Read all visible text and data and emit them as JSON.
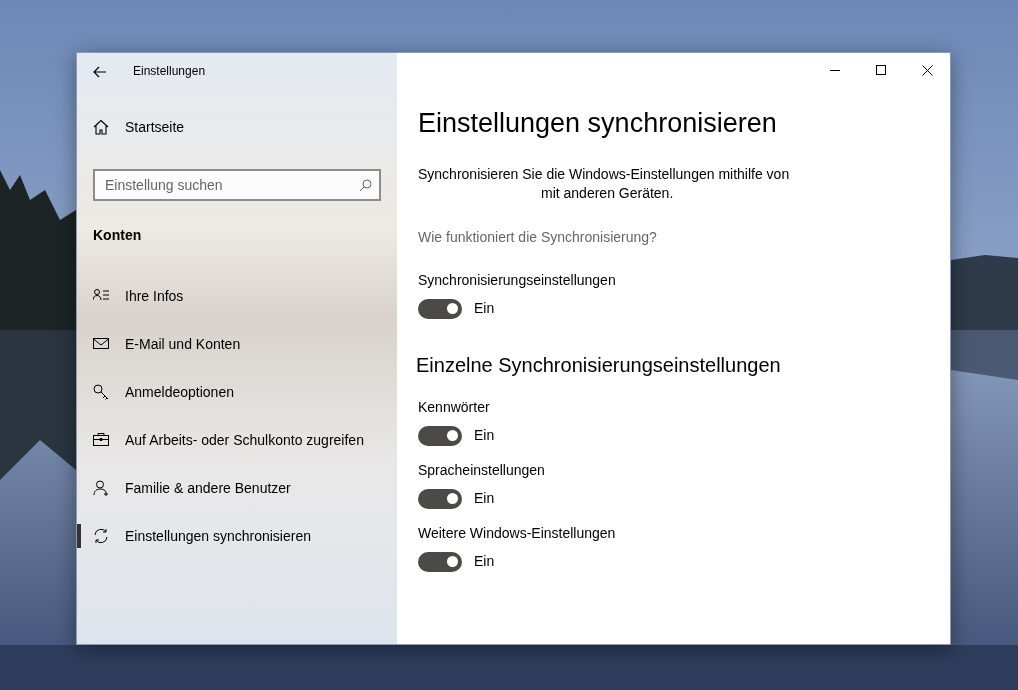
{
  "window": {
    "title": "Einstellungen"
  },
  "sidebar": {
    "home": "Startseite",
    "search": {
      "placeholder": "Einstellung suchen"
    },
    "section": "Konten",
    "items": [
      {
        "label": "Ihre Infos",
        "kind": "info",
        "selected": false
      },
      {
        "label": "E-Mail und Konten",
        "kind": "mail",
        "selected": false
      },
      {
        "label": "Anmeldeoptionen",
        "kind": "signin",
        "selected": false
      },
      {
        "label": "Auf Arbeits- oder Schulkonto zugreifen",
        "kind": "work",
        "selected": false
      },
      {
        "label": "Familie & andere Benutzer",
        "kind": "family",
        "selected": false
      },
      {
        "label": "Einstellungen synchronisieren",
        "kind": "sync",
        "selected": true
      }
    ]
  },
  "main": {
    "title": "Einstellungen synchronisieren",
    "description": [
      "Synchronisieren Sie die Windows-Einstellungen mithilfe von",
      "mit anderen Geräten."
    ],
    "link": "Wie funktioniert die Synchronisierung?",
    "settings": [
      {
        "label": "Synchronisierungseinstellungen",
        "on": true,
        "disabled": true,
        "state": "Ein"
      }
    ],
    "section": "Einzelne Synchronisierungseinstellungen",
    "individual": [
      {
        "label": "Kennwörter",
        "on": true,
        "disabled": true,
        "state": "Ein"
      },
      {
        "label": "Spracheinstellungen",
        "on": true,
        "disabled": true,
        "state": "Ein"
      },
      {
        "label": "Weitere Windows-Einstellungen",
        "on": true,
        "disabled": true,
        "state": "Ein"
      }
    ]
  }
}
